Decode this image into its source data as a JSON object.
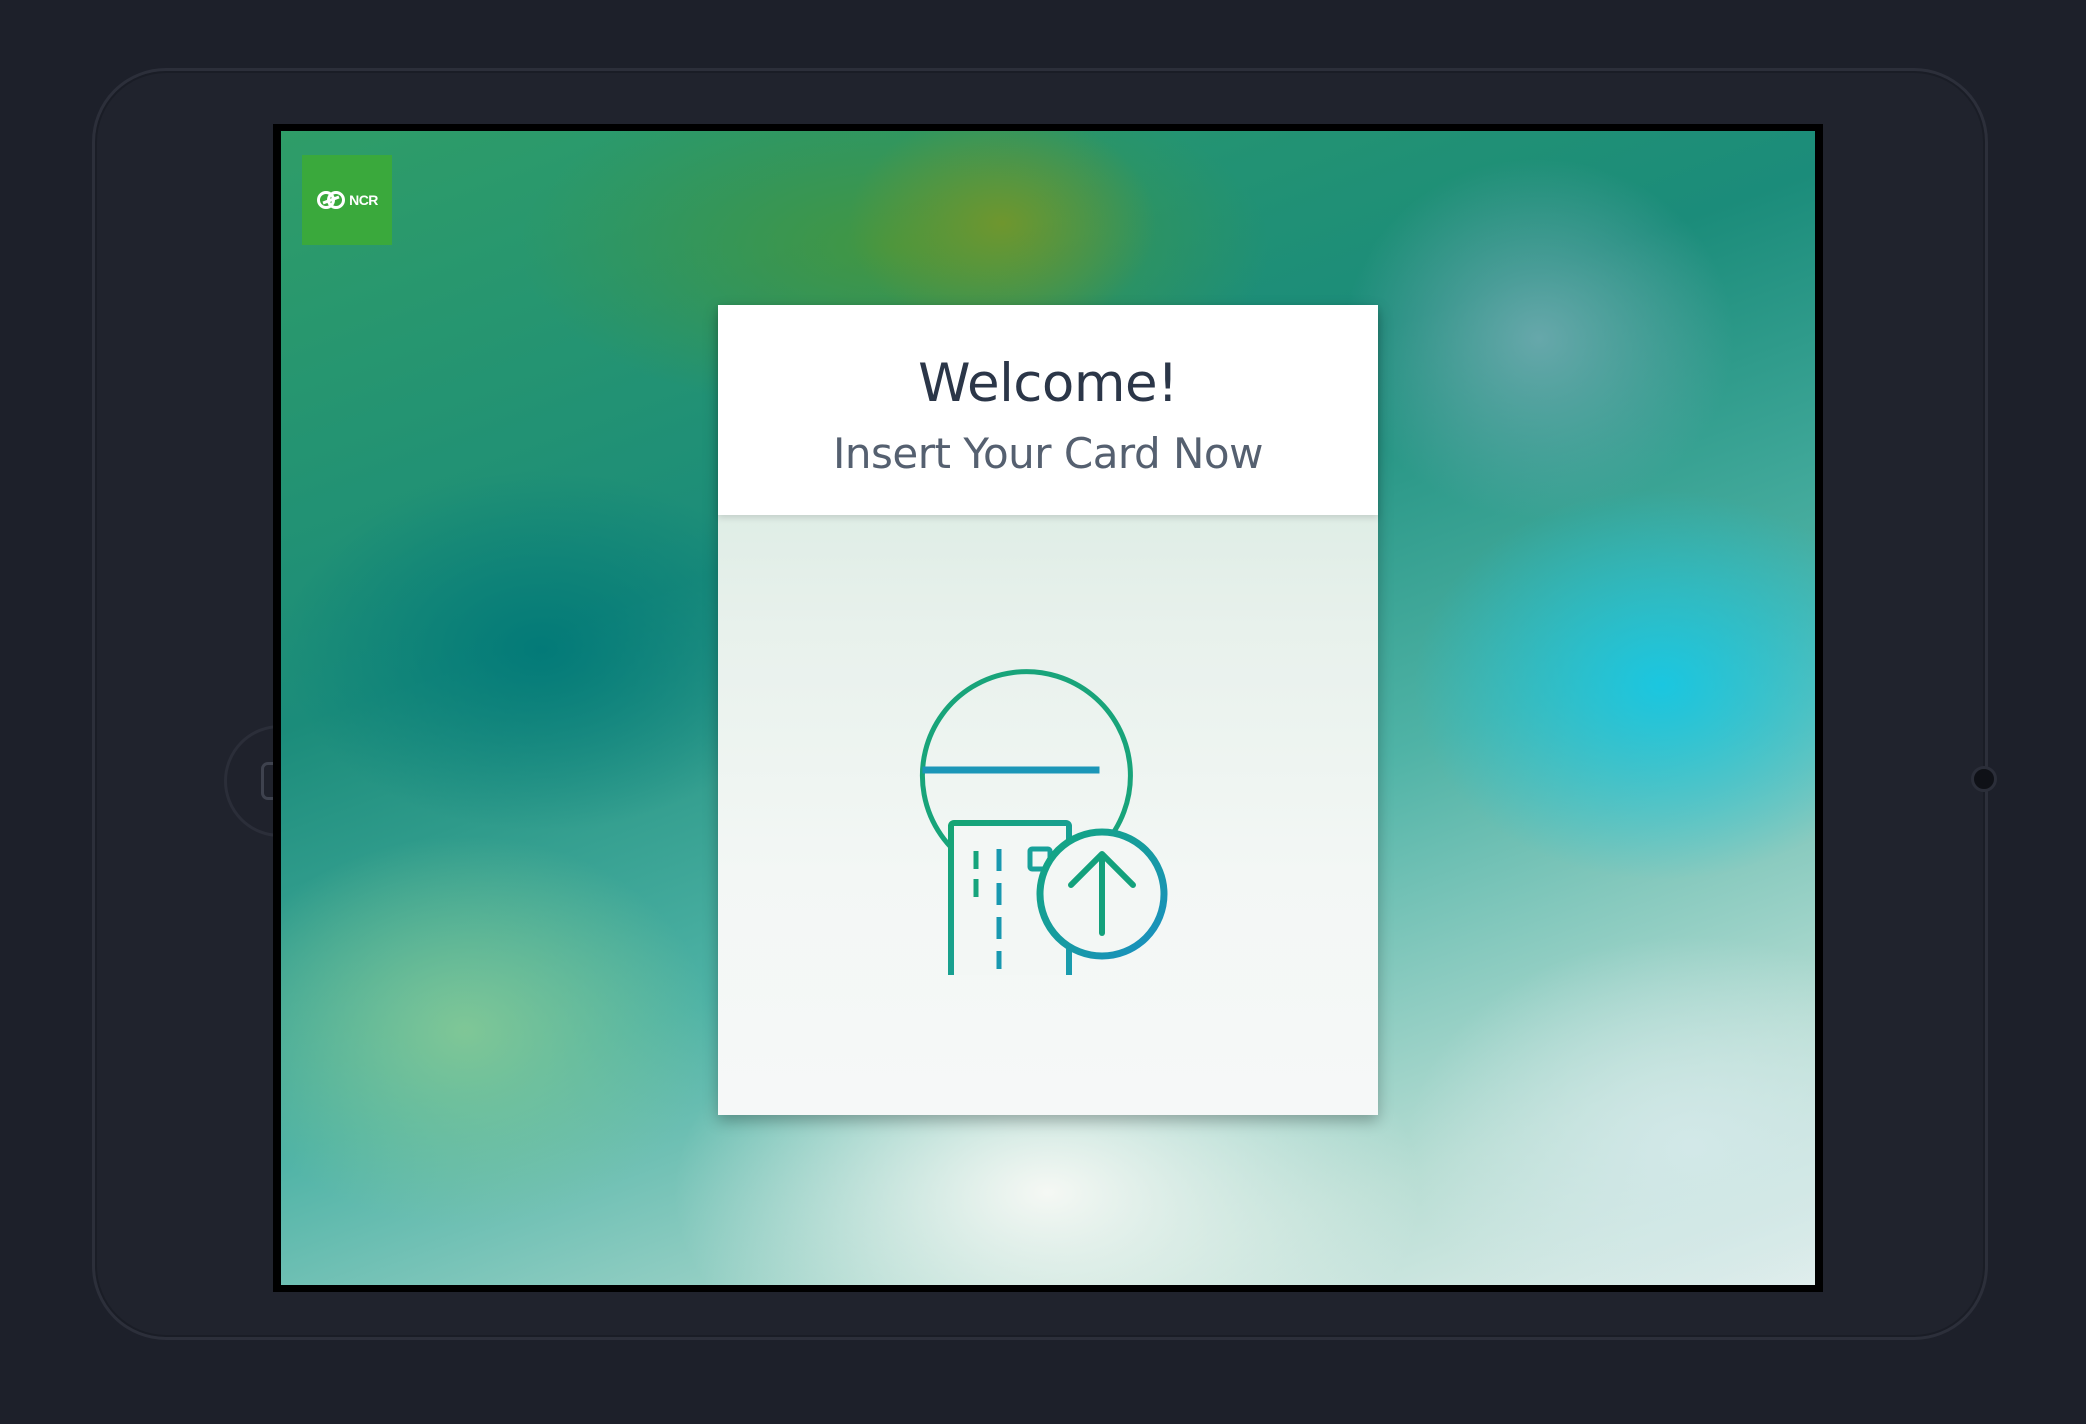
{
  "brand": {
    "logo_text": "NCR",
    "logo_color": "#3aa93c"
  },
  "card": {
    "title": "Welcome!",
    "subtitle": "Insert Your Card Now"
  },
  "icons": {
    "illustration": "insert-card-icon",
    "home": "home-button-icon"
  },
  "colors": {
    "icon_green": "#1ea584",
    "icon_blue": "#1994bf",
    "title_text": "#2b3648",
    "subtitle_text": "#556070"
  }
}
